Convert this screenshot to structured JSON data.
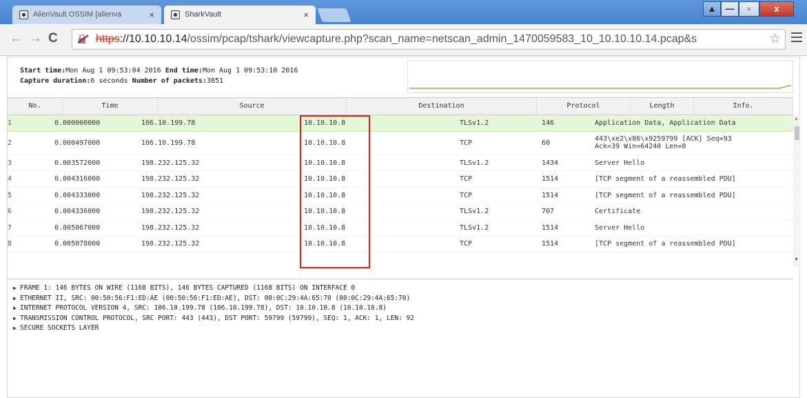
{
  "browser": {
    "tabs": [
      {
        "title": "AlienVault OSSIM [alienva",
        "active": false
      },
      {
        "title": "SharkVault",
        "active": true
      }
    ],
    "close_glyph": "×",
    "window_controls": {
      "minimize": "▲",
      "restore": "—",
      "maximize": "▫",
      "close": "x"
    },
    "address": {
      "scheme": "https",
      "host_path": "://10.10.10.14",
      "rest": "/ossim/pcap/tshark/viewcapture.php?scan_name=netscan_admin_1470059583_10_10.10.10.14.pcap&s"
    }
  },
  "capture": {
    "start_label": "Start time:",
    "start_value": "Mon Aug 1 09:53:04 2016",
    "end_label": "End time:",
    "end_value": "Mon Aug 1 09:53:10 2016",
    "duration_label": "Capture duration:",
    "duration_value": "6 seconds",
    "packets_label": "Number of packets:",
    "packets_value": "3851"
  },
  "packets": {
    "columns": [
      "No.",
      "Time",
      "Source",
      "Destination",
      "Protocol",
      "Length",
      "Info."
    ],
    "rows": [
      {
        "no": "1",
        "time": "0.000000000",
        "src": "106.10.199.78",
        "dst": "10.10.10.8",
        "proto": "TLSv1.2",
        "len": "146",
        "info": "Application Data, Application Data"
      },
      {
        "no": "2",
        "time": "0.000497000",
        "src": "106.10.199.78",
        "dst": "10.10.10.8",
        "proto": "TCP",
        "len": "60",
        "info": "443\\xe2\\x86\\x9259799 [ACK] Seq=93",
        "info2": "Ack=39 Win=64240 Len=0"
      },
      {
        "no": "3",
        "time": "0.003572000",
        "src": "198.232.125.32",
        "dst": "10.10.10.8",
        "proto": "TLSv1.2",
        "len": "1434",
        "info": "Server Hello"
      },
      {
        "no": "4",
        "time": "0.004316000",
        "src": "198.232.125.32",
        "dst": "10.10.10.8",
        "proto": "TCP",
        "len": "1514",
        "info": "[TCP segment of a reassembled PDU]"
      },
      {
        "no": "5",
        "time": "0.004333000",
        "src": "198.232.125.32",
        "dst": "10.10.10.8",
        "proto": "TCP",
        "len": "1514",
        "info": "[TCP segment of a reassembled PDU]"
      },
      {
        "no": "6",
        "time": "0.004336000",
        "src": "198.232.125.32",
        "dst": "10.10.10.8",
        "proto": "TLSv1.2",
        "len": "707",
        "info": "Certificate"
      },
      {
        "no": "7",
        "time": "0.005067000",
        "src": "198.232.125.32",
        "dst": "10.10.10.8",
        "proto": "TLSv1.2",
        "len": "1514",
        "info": "Server Hello"
      },
      {
        "no": "8",
        "time": "0.005078000",
        "src": "198.232.125.32",
        "dst": "10.10.10.8",
        "proto": "TCP",
        "len": "1514",
        "info": "[TCP segment of a reassembled PDU]"
      }
    ]
  },
  "details": [
    "FRAME 1: 146 BYTES ON WIRE (1168 BITS), 146 BYTES CAPTURED (1168 BITS) ON INTERFACE 0",
    "ETHERNET II, SRC: 00:50:56:F1:ED:AE (00:50:56:F1:ED:AE), DST: 00:0C:29:4A:65:70 (00:0C:29:4A:65:70)",
    "INTERNET PROTOCOL VERSION 4, SRC: 106.10.199.78 (106.10.199.78), DST: 10.10.10.8 (10.10.10.8)",
    "TRANSMISSION CONTROL PROTOCOL, SRC PORT: 443 (443), DST PORT: 59799 (59799), SEQ: 1, ACK: 1, LEN: 92",
    "SECURE SOCKETS LAYER"
  ],
  "icons": {
    "back": "←",
    "forward": "→",
    "reload": "C",
    "star": "☆",
    "tree_arrow": "▶",
    "scroll_up": "▲",
    "scroll_down": "▼"
  },
  "colors": {
    "selected_row": "#e4f7d6",
    "highlight_box": "#e02020",
    "scheme_strike": "#c0392b",
    "sparkline": "#7ac143"
  }
}
